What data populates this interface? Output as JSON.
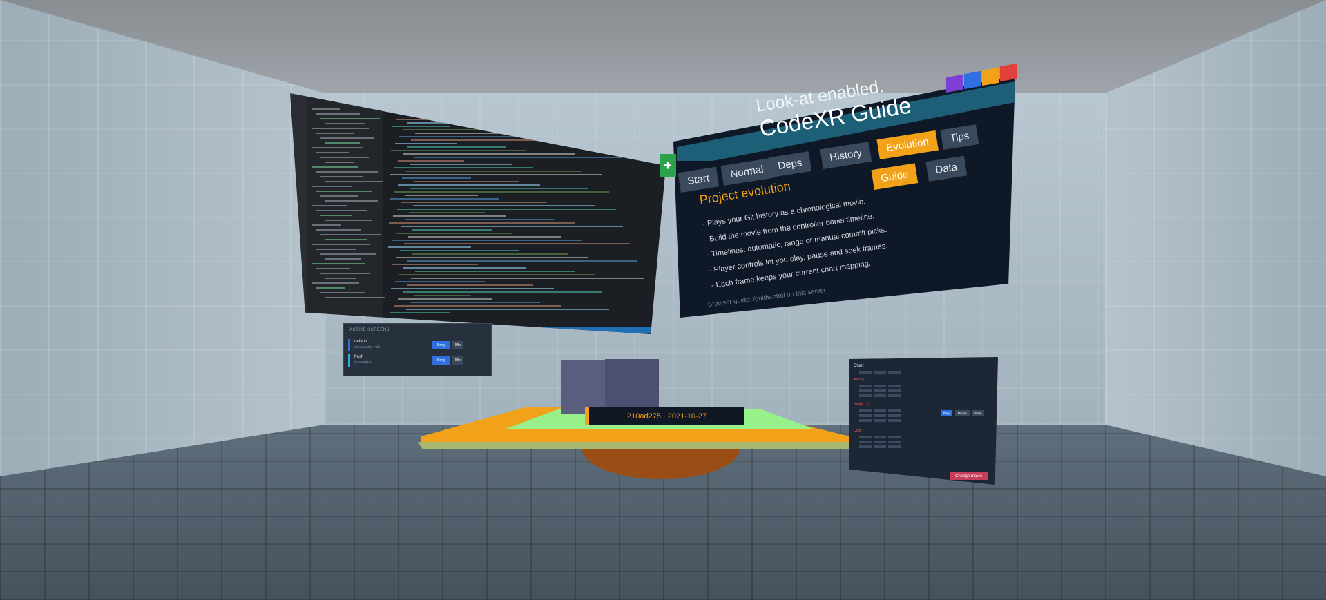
{
  "scene": {
    "lookat_label": "Look-at enabled.",
    "swatch_colors": [
      "#7e3fd6",
      "#2f6fe0",
      "#f2a219",
      "#e0413a"
    ]
  },
  "guide": {
    "title": "CodeXR Guide",
    "tabs_row1": [
      "Start",
      "Normal",
      "Deps",
      "History",
      "Evolution",
      "Tips"
    ],
    "active_tab": "Evolution",
    "tabs_row2": [
      "Guide",
      "Data"
    ],
    "active_subtab": "Guide",
    "section_title": "Project evolution",
    "items": [
      "- Plays your Git history as a chronological movie.",
      "- Build the movie from the controller panel timeline.",
      "- Timelines: automatic, range or manual commit picks.",
      "- Player controls let you play, pause and seek frames.",
      "- Each frame keeps your current chart mapping."
    ],
    "footer": "Browser guide: /guide.html on this server",
    "add_button": "+"
  },
  "sessions": {
    "title": "ACTIVE SCREENS",
    "rows": [
      {
        "name": "default",
        "sub": "Windows File Fold",
        "bring": "Bring",
        "min": "Min",
        "color": "#2f6fe0"
      },
      {
        "name": "fresh",
        "sub": "Fresh Editor",
        "bring": "Bring",
        "min": "Min",
        "color": "#2ab0e0"
      }
    ]
  },
  "commit": {
    "hash": "210ad275",
    "separator": "·",
    "date": "2021-10-27",
    "text": "210ad275 · 2021-10-27"
  },
  "controller": {
    "sections": [
      "Chart",
      "Axis (X)",
      "Height (Y)",
      "Color"
    ],
    "controls": [
      "Play",
      "Pause",
      "Seek"
    ],
    "change_movie": "Change movie"
  }
}
